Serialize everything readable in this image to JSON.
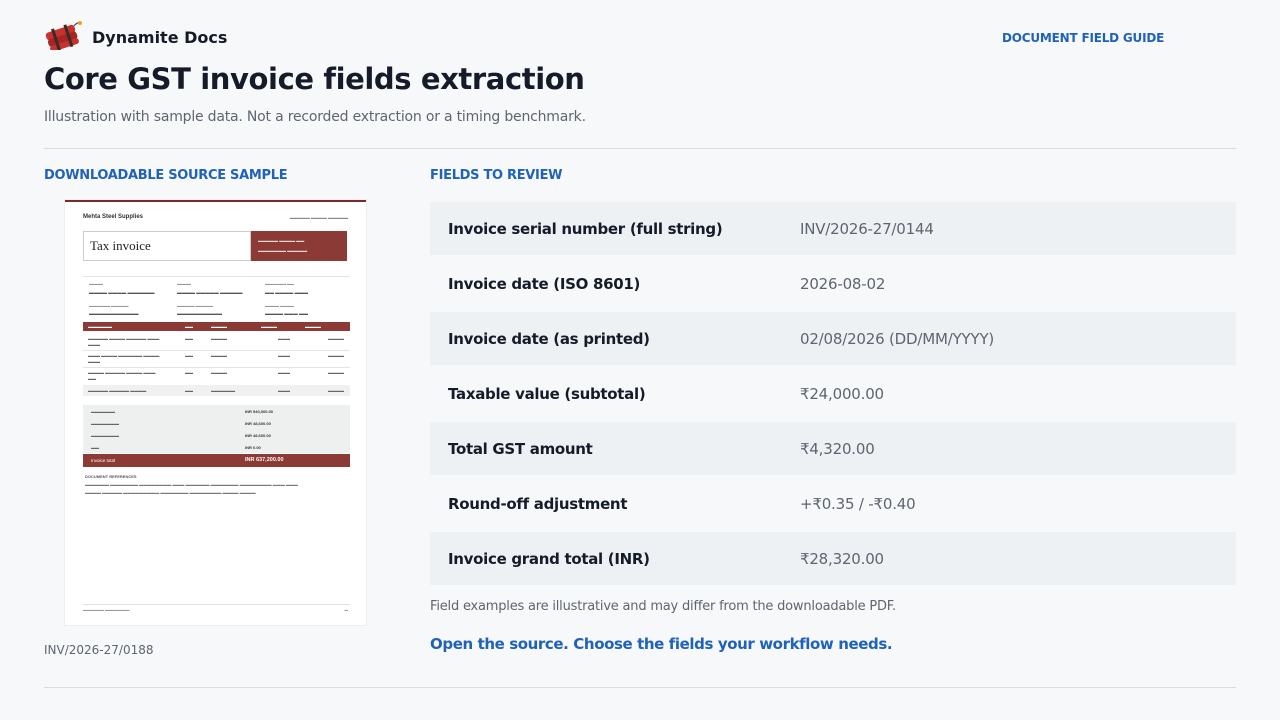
{
  "header": {
    "brand_name": "Dynamite Docs",
    "logo_icon": "dynamite-icon",
    "guide_link": "DOCUMENT FIELD GUIDE",
    "title": "Core GST invoice fields extraction",
    "subtitle": "Illustration with sample data. Not a recorded extraction or a timing benchmark."
  },
  "colors": {
    "accent": "#2062b8",
    "doc_red": "#8b3a35",
    "row_shade": "#eef1f4"
  },
  "source": {
    "heading": "DOWNLOADABLE SOURCE SAMPLE",
    "doc_id": "INV/2026-27/0188",
    "preview": {
      "company": "Mehta Steel Supplies",
      "doc_title": "Tax invoice",
      "total_label": "Invoice total",
      "total_value": "INR 637,200.00",
      "taxable_value": "INR 540,000.00",
      "cgst_value": "INR 48,600.00",
      "sgst_value": "INR 48,600.00",
      "roundoff_value": "INR 0.00",
      "notes_heading": "DOCUMENT REFERENCES"
    }
  },
  "fields": {
    "heading": "FIELDS TO REVIEW",
    "rows": [
      {
        "label": "Invoice serial number (full string)",
        "value": "INV/2026-27/0144"
      },
      {
        "label": "Invoice date (ISO 8601)",
        "value": "2026-08-02"
      },
      {
        "label": "Invoice date (as printed)",
        "value": "02/08/2026 (DD/MM/YYYY)"
      },
      {
        "label": "Taxable value (subtotal)",
        "value": "₹24,000.00"
      },
      {
        "label": "Total GST amount",
        "value": "₹4,320.00"
      },
      {
        "label": "Round-off adjustment",
        "value": "+₹0.35 / -₹0.40"
      },
      {
        "label": "Invoice grand total (INR)",
        "value": "₹28,320.00"
      }
    ],
    "disclaimer": "Field examples are illustrative and may differ from the downloadable PDF.",
    "cta": "Open the source. Choose the fields your workflow needs."
  }
}
